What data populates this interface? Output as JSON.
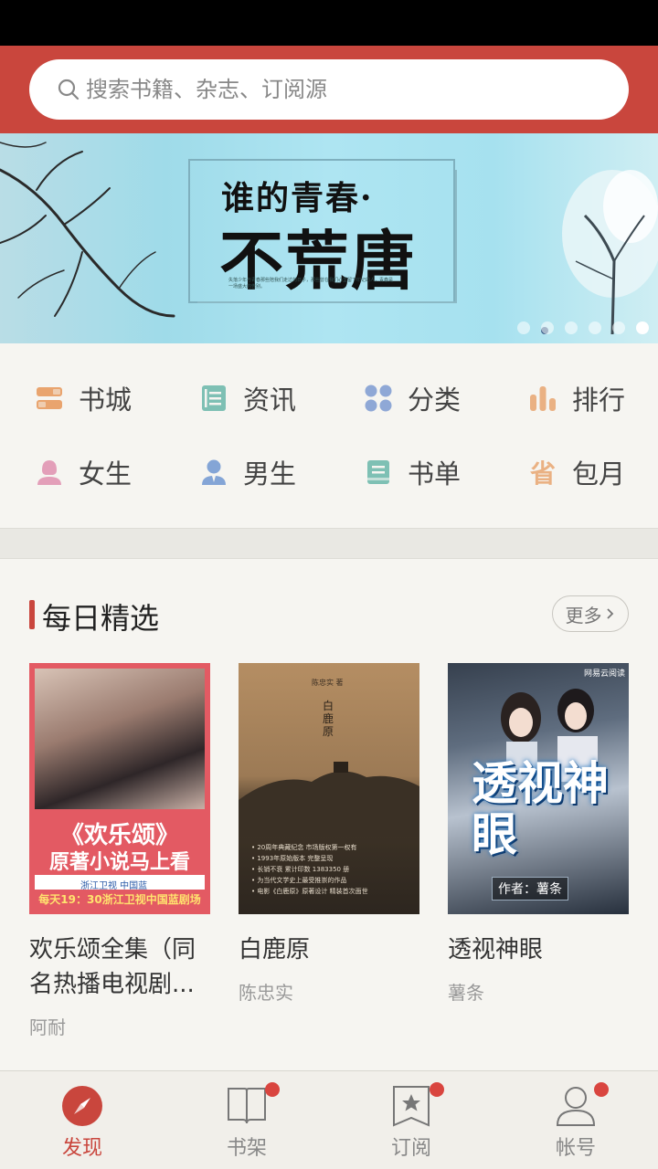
{
  "search": {
    "placeholder": "搜索书籍、杂志、订阅源"
  },
  "banner": {
    "title_line1": "谁的青春·",
    "title_line2": "不荒唐",
    "fine_print": "失落少年与青春那些陪我们走过的日子，那些曾在我们心里留下印记的人，青春是一场盛大的告别。",
    "slide_count": 6,
    "active_slide": 6
  },
  "nav": {
    "items": [
      {
        "label": "书城",
        "icon": "bookstore-icon",
        "color": "#e9a46e"
      },
      {
        "label": "资讯",
        "icon": "news-icon",
        "color": "#7ec0b4"
      },
      {
        "label": "分类",
        "icon": "category-icon",
        "color": "#8fa8d6"
      },
      {
        "label": "排行",
        "icon": "ranking-icon",
        "color": "#eab183"
      },
      {
        "label": "女生",
        "icon": "female-icon",
        "color": "#e39fb9"
      },
      {
        "label": "男生",
        "icon": "male-icon",
        "color": "#84a5d6"
      },
      {
        "label": "书单",
        "icon": "booklist-icon",
        "color": "#7ec0b4"
      },
      {
        "label": "包月",
        "icon": "monthly-icon",
        "color": "#eab183"
      }
    ]
  },
  "daily": {
    "title": "每日精选",
    "more_label": "更多",
    "books": [
      {
        "title": "欢乐颂全集（同名热播电视剧...",
        "author": "阿耐",
        "cover_line1": "《欢乐颂》",
        "cover_line2": "原著小说马上看",
        "cover_line3": "浙江卫视 中国蓝",
        "cover_line4": "每天19：30浙江卫视中国蓝剧场"
      },
      {
        "title": "白鹿原",
        "author": "陈忠实",
        "cover_header": "陈忠实 著",
        "cover_vertical": "白鹿原",
        "cover_notes": [
          "• 20周年典藏纪念 市场版权第一权有",
          "• 1993年原始版本 完整呈现",
          "• 长销不衰 累计印数 1383350 册",
          "• 为当代文学史上最受推崇的作品",
          "• 电影《白鹿原》原著设计 精装首次面世"
        ]
      },
      {
        "title": "透视神眼",
        "author": "薯条",
        "cover_publisher": "网易云阅读",
        "cover_big": "透视神眼",
        "cover_author": "作者：薯条"
      }
    ]
  },
  "tabs": [
    {
      "label": "发现",
      "icon": "compass-icon",
      "active": true,
      "badge": false
    },
    {
      "label": "书架",
      "icon": "bookshelf-icon",
      "active": false,
      "badge": true
    },
    {
      "label": "订阅",
      "icon": "subscribe-icon",
      "active": false,
      "badge": true
    },
    {
      "label": "帐号",
      "icon": "account-icon",
      "active": false,
      "badge": true
    }
  ],
  "colors": {
    "brand": "#c9463d",
    "background": "#f6f5f1",
    "badge": "#d9453f"
  }
}
